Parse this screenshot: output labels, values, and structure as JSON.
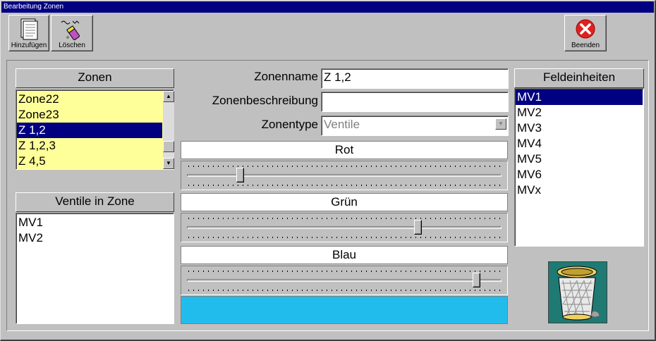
{
  "window": {
    "title": "Bearbeitung Zonen"
  },
  "toolbar": {
    "add_label": "Hinzufügen",
    "delete_label": "Löschen",
    "quit_label": "Beenden",
    "add_icon": "document-icon",
    "delete_icon": "eraser-icon",
    "quit_icon": "close-icon"
  },
  "zones": {
    "header": "Zonen",
    "items": [
      "Zone22",
      "Zone23",
      "Z 1,2",
      "Z 1,2,3",
      "Z 4,5"
    ],
    "selected_index": 2,
    "item_bg": "#ffff99",
    "scroll_fraction": 0.88
  },
  "valves_in_zone": {
    "header": "Ventile in Zone",
    "items": [
      "MV1",
      "MV2"
    ]
  },
  "form": {
    "name_label": "Zonenname",
    "name_value": "Z 1,2",
    "desc_label": "Zonenbeschreibung",
    "desc_value": "",
    "type_label": "Zonentype",
    "type_value": "Ventile"
  },
  "colors": {
    "red_label": "Rot",
    "green_label": "Grün",
    "blue_label": "Blau",
    "red_level": 0.16,
    "green_level": 0.74,
    "blue_level": 0.93,
    "preview_color": "#21bcec"
  },
  "field_units": {
    "header": "Feldeinheiten",
    "items": [
      "MV1",
      "MV2",
      "MV3",
      "MV4",
      "MV5",
      "MV6",
      "MVx"
    ],
    "selected_index": 0
  },
  "trash": {
    "icon": "trash-can-icon",
    "bg": "#1f7a74"
  },
  "theme": {
    "selection": "#000080",
    "titlebar": "#000080"
  }
}
